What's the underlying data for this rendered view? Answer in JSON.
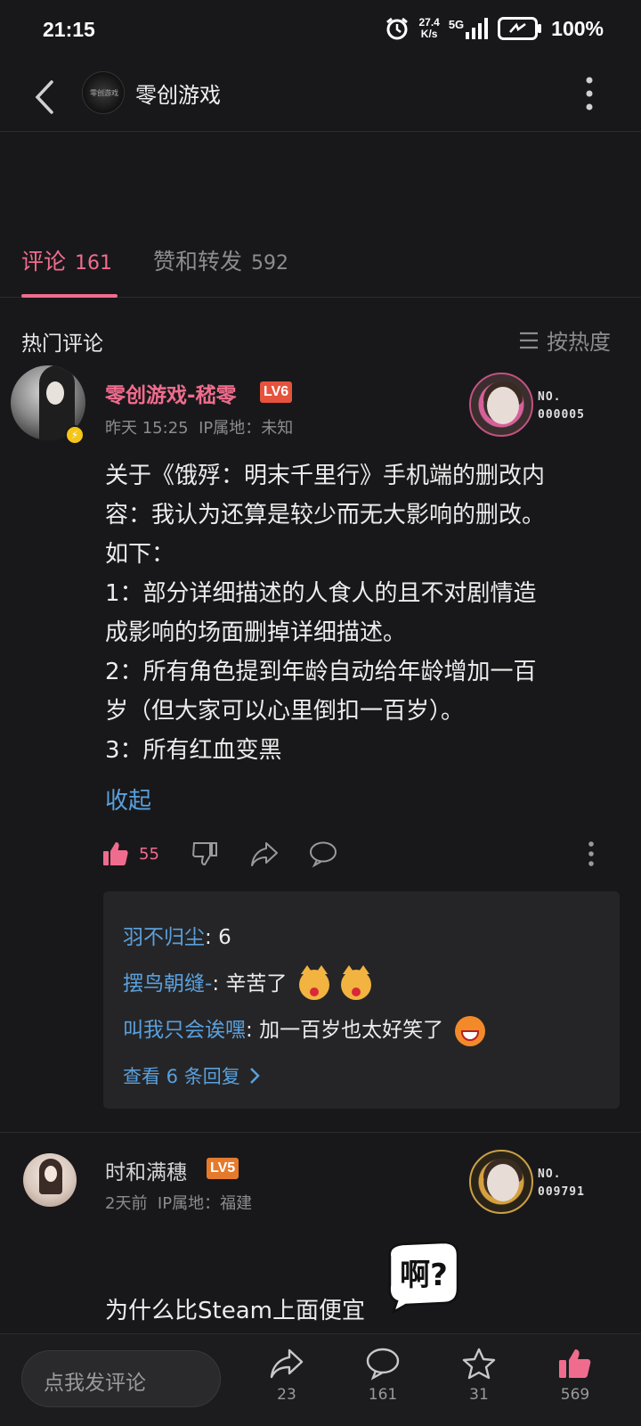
{
  "status_bar": {
    "time": "21:15",
    "net_speed_value": "27.4",
    "net_speed_unit": "K/s",
    "network": "5G",
    "battery": "100%"
  },
  "header": {
    "title": "零创游戏",
    "avatar_text": "零创游戏"
  },
  "tabs": [
    {
      "label": "评论",
      "count": "161",
      "active": true
    },
    {
      "label": "赞和转发",
      "count": "592",
      "active": false
    }
  ],
  "hot_comments": {
    "title": "热门评论",
    "sort_label": "按热度"
  },
  "comments": [
    {
      "author": "零创游戏-嵇零",
      "level": "LV6",
      "time": "昨天 15:25",
      "ip": "IP属地：未知",
      "fan_no_label": "NO.",
      "fan_no": "000005",
      "lines": [
        "关于《饿殍：明末千里行》手机端的删改内",
        "容：我认为还算是较少而无大影响的删改。",
        "如下：",
        "1：部分详细描述的人食人的且不对剧情造",
        "成影响的场面删掉详细描述。",
        "2：所有角色提到年龄自动给年龄增加一百",
        "岁（但大家可以心里倒扣一百岁）。",
        "3：所有红血变黑"
      ],
      "collapse_label": "收起",
      "likes": "55",
      "replies": [
        {
          "name": "羽不归尘",
          "text": "6"
        },
        {
          "name": "摆鸟朝缝-",
          "text": "辛苦了"
        },
        {
          "name": "叫我只会诶嘿",
          "text": "加一百岁也太好笑了"
        }
      ],
      "view_replies_label": "查看 6 条回复"
    },
    {
      "author": "时和满穗",
      "level": "LV5",
      "time": "2天前",
      "ip": "IP属地：福建",
      "fan_no_label": "NO.",
      "fan_no": "009791",
      "text": "为什么比Steam上面便宜",
      "sticker_text": "啊?"
    }
  ],
  "bottom_bar": {
    "input_placeholder": "点我发评论",
    "share_count": "23",
    "comment_count": "161",
    "favorite_count": "31",
    "like_count": "569"
  },
  "colors": {
    "background": "#18181a",
    "accent_pink": "#f06c8e",
    "link_blue": "#5aa0dc",
    "lv6_badge": "#e5533d",
    "lv5_badge": "#e57a2d"
  }
}
